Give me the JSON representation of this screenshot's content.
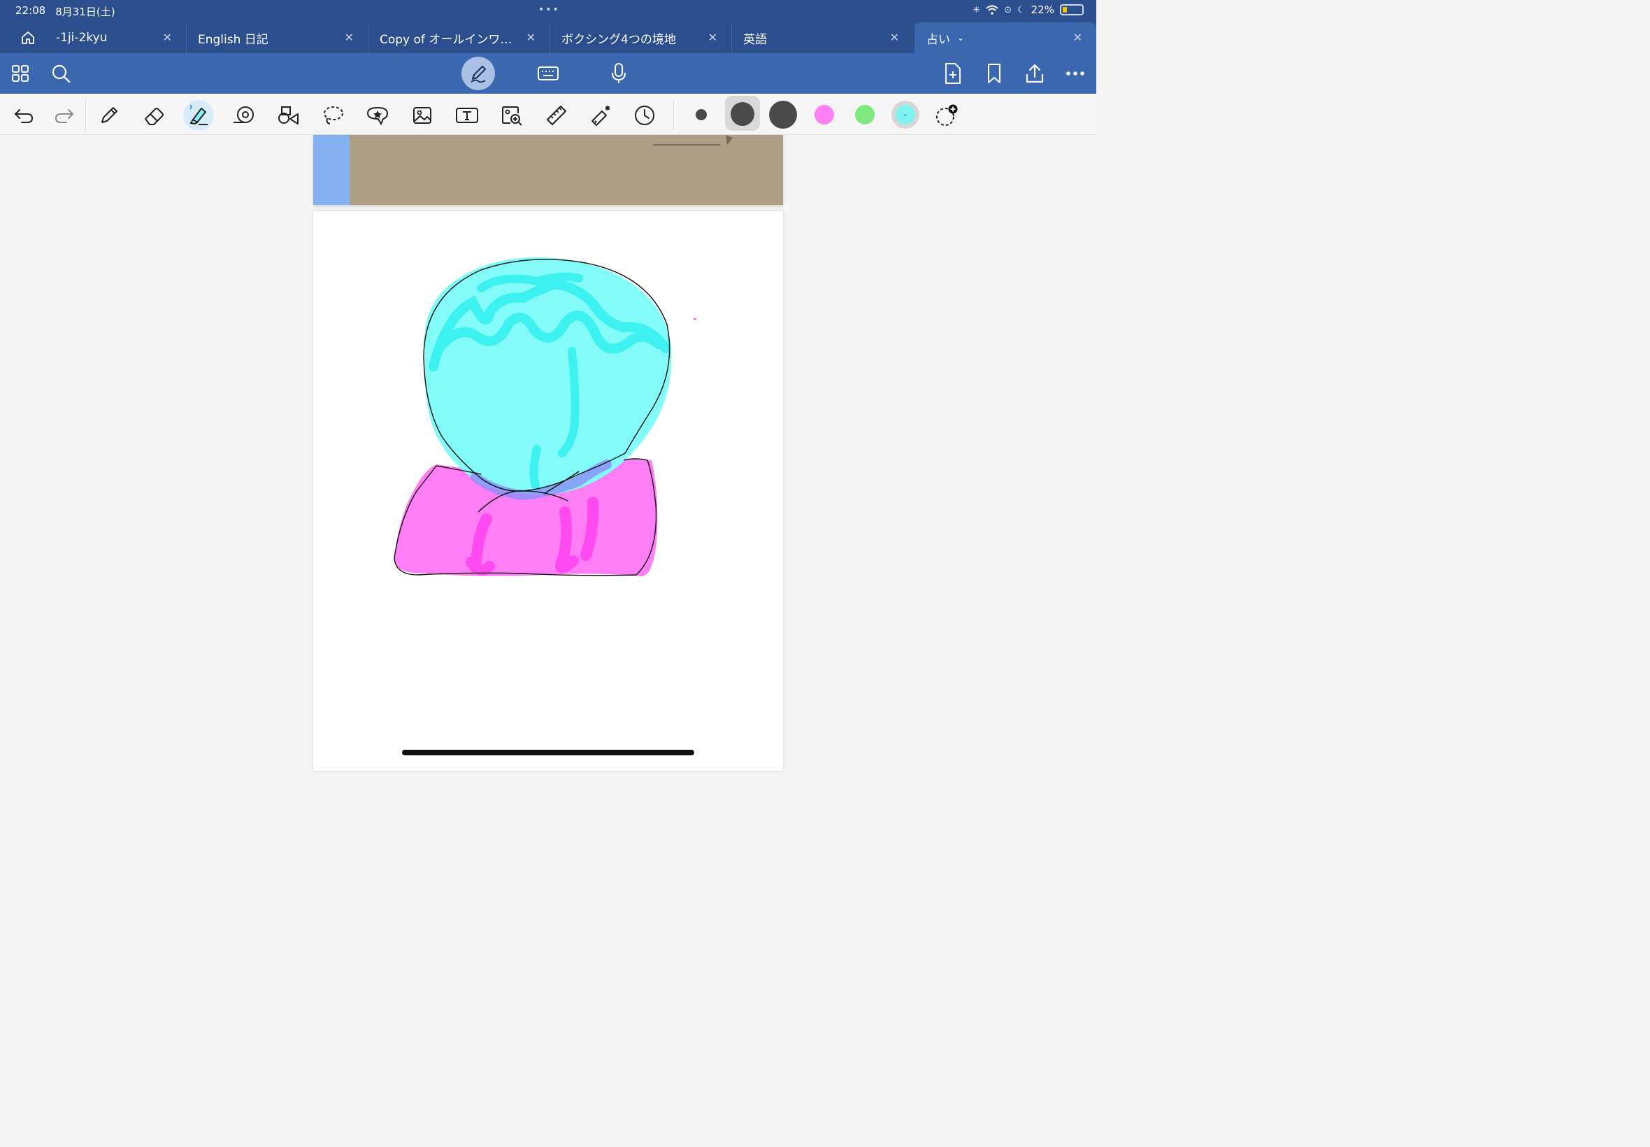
{
  "status": {
    "time": "22:08",
    "date": "8月31日(土)",
    "battery": "22%",
    "battery_level": 0.22
  },
  "tabs": [
    {
      "label": "-1ji-2kyu",
      "active": false
    },
    {
      "label": "English 日記",
      "active": false
    },
    {
      "label": "Copy of オールインワ…",
      "active": false
    },
    {
      "label": "ボクシング4つの境地",
      "active": false
    },
    {
      "label": "英語",
      "active": false
    },
    {
      "label": "占い",
      "active": true
    }
  ],
  "toolbar": {
    "left_icons": [
      "grid-icon",
      "search-icon"
    ],
    "mode_icons": [
      "pen-mode-icon",
      "keyboard-icon",
      "microphone-icon"
    ],
    "right_icons": [
      "add-page-icon",
      "bookmark-icon",
      "share-icon",
      "more-icon"
    ]
  },
  "tools": [
    "undo",
    "redo",
    "pencil",
    "eraser",
    "highlighter",
    "tape",
    "shapes",
    "lasso",
    "sticker",
    "image",
    "text",
    "image-search",
    "ruler",
    "laser-pointer",
    "recent"
  ],
  "colors": {
    "swatches": [
      "#4a4a4a",
      "#4a4a4a",
      "#4a4a4a",
      "#ff80f2",
      "#7eea7e",
      "#7ff2f2"
    ],
    "selected_swatch": "#7ff2f2",
    "highlighter_cyan": "#5cf7f5",
    "highlighter_magenta": "#ff6bf6",
    "app_blue": "#2a4f8c"
  }
}
